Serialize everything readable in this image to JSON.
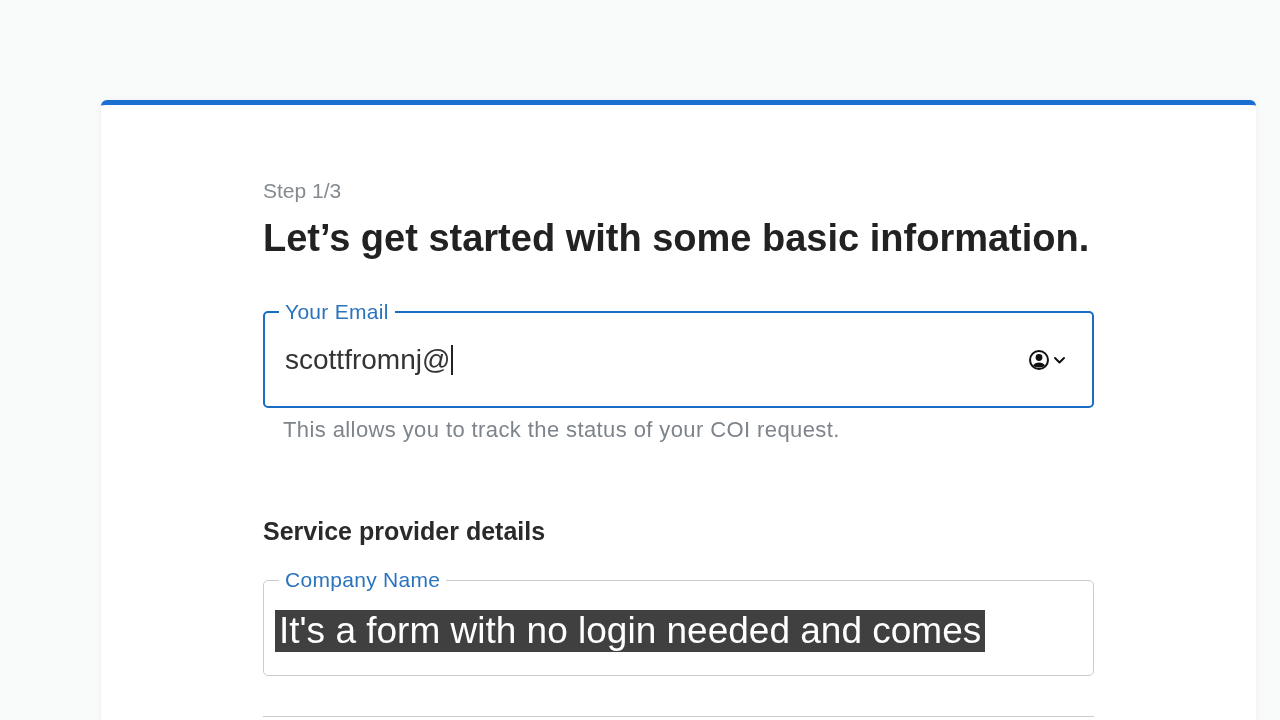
{
  "form": {
    "step": "Step 1/3",
    "heading": "Let’s get started with some basic information.",
    "email": {
      "label": "Your Email",
      "value": "scottfromnj@",
      "focused": true,
      "helper": "This allows you to track the status of your COI request."
    },
    "section_title": "Service provider details",
    "company": {
      "label": "Company Name",
      "focused": false
    }
  },
  "caption": "It's a form with no login needed and comes"
}
